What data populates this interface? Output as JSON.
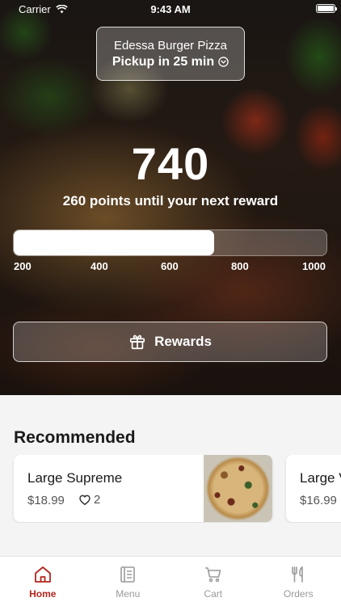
{
  "status_bar": {
    "carrier": "Carrier",
    "time": "9:43 AM"
  },
  "store": {
    "name": "Edessa Burger Pizza",
    "pickup": "Pickup in 25 min"
  },
  "points": {
    "value": "740",
    "caption": "260 points until your next reward",
    "progress_value": 740,
    "scale_min": 100,
    "scale_max": 1100,
    "ticks": [
      "200",
      "400",
      "600",
      "800",
      "1000"
    ]
  },
  "rewards_button": {
    "label": "Rewards"
  },
  "recommended": {
    "title": "Recommended",
    "items": [
      {
        "name": "Large Supreme",
        "price": "$18.99",
        "likes": "2"
      },
      {
        "name": "Large V",
        "price": "$16.99"
      }
    ]
  },
  "tabs": [
    {
      "label": "Home",
      "icon": "home-icon",
      "active": true
    },
    {
      "label": "Menu",
      "icon": "menu-icon",
      "active": false
    },
    {
      "label": "Cart",
      "icon": "cart-icon",
      "active": false
    },
    {
      "label": "Orders",
      "icon": "orders-icon",
      "active": false
    }
  ],
  "colors": {
    "accent": "#b3261e",
    "tab_inactive": "#9a9a9a"
  }
}
